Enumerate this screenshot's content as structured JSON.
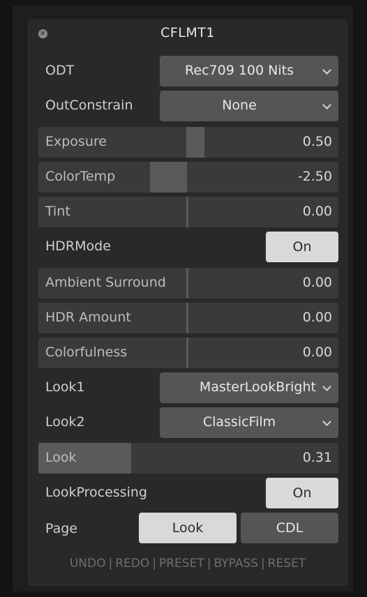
{
  "window": {
    "title": "CFLMT1",
    "close_icon": "close-icon"
  },
  "rows": {
    "odt": {
      "label": "ODT",
      "value": "Rec709 100 Nits"
    },
    "outconstrain": {
      "label": "OutConstrain",
      "value": "None"
    },
    "exposure": {
      "label": "Exposure",
      "value": "0.50"
    },
    "colortemp": {
      "label": "ColorTemp",
      "value": "-2.50"
    },
    "tint": {
      "label": "Tint",
      "value": "0.00"
    },
    "hdrmode": {
      "label": "HDRMode",
      "toggle": "On"
    },
    "ambient": {
      "label": "Ambient Surround",
      "value": "0.00"
    },
    "hdr_amount": {
      "label": "HDR Amount",
      "value": "0.00"
    },
    "colorfulness": {
      "label": "Colorfulness",
      "value": "0.00"
    },
    "look1": {
      "label": "Look1",
      "value": "MasterLookBright"
    },
    "look2": {
      "label": "Look2",
      "value": "ClassicFilm"
    },
    "look": {
      "label": "Look",
      "value": "0.31"
    },
    "lookprocessing": {
      "label": "LookProcessing",
      "toggle": "On"
    },
    "page": {
      "label": "Page",
      "active": "Look",
      "inactive": "CDL"
    }
  },
  "footer": {
    "undo": "UNDO",
    "redo": "REDO",
    "preset": "PRESET",
    "bypass": "BYPASS",
    "reset": "RESET",
    "separator": "|"
  },
  "colors": {
    "panel_bg": "#292929",
    "control_bg": "#555555",
    "slider_track": "#3a3a3a",
    "slider_fill": "#5a5a5a",
    "toggle_on": "#d9d9d9"
  }
}
